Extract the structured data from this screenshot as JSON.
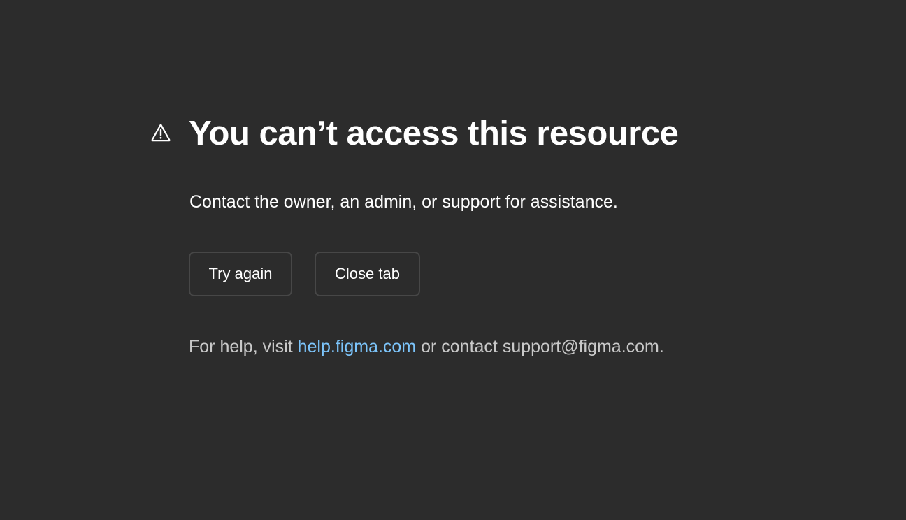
{
  "page": {
    "title": "You can’t access this resource",
    "subtitle": "Contact the owner, an admin, or support for assistance.",
    "icon": "warning-triangle-icon"
  },
  "actions": {
    "try_again_label": "Try again",
    "close_tab_label": "Close tab"
  },
  "help": {
    "prefix": "For help, visit ",
    "link_text": "help.figma.com",
    "middle": " or contact ",
    "email": "support@figma.com",
    "suffix": "."
  },
  "colors": {
    "background": "#2c2c2c",
    "text": "#ffffff",
    "muted_text": "#c9c9c9",
    "link": "#7cc4fa",
    "button_border": "#474747"
  }
}
